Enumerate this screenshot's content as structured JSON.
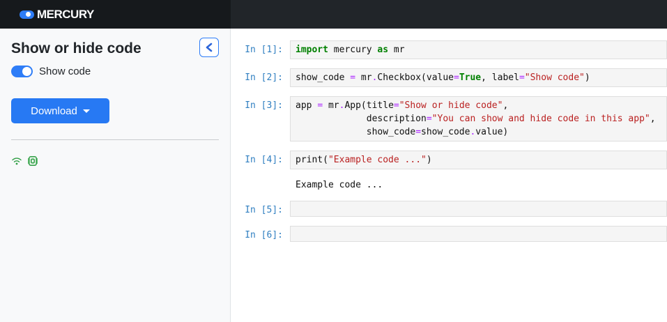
{
  "header": {
    "brand": "MERCURY"
  },
  "sidebar": {
    "title": "Show or hide code",
    "show_code_label": "Show code",
    "show_code_value": true,
    "download_label": "Download"
  },
  "colors": {
    "accent_blue": "#2779f3",
    "toggle_blue": "#2e7df7",
    "status_green": "#2f9e44",
    "prompt_blue": "#307fc1",
    "keyword_green": "#008000",
    "operator_violet": "#AA22FF",
    "string_red": "#BA2121",
    "navbar_dark": "#212529",
    "sidebar_bg": "#f8f9fa",
    "cell_bg": "#f5f5f5"
  },
  "notebook": {
    "cells": [
      {
        "prompt": "In [1]:",
        "lines": [
          [
            [
              "k",
              "import"
            ],
            [
              "t",
              " mercury "
            ],
            [
              "k",
              "as"
            ],
            [
              "t",
              " mr"
            ]
          ]
        ]
      },
      {
        "prompt": "In [2]:",
        "lines": [
          [
            [
              "t",
              "show_code "
            ],
            [
              "o",
              "="
            ],
            [
              "t",
              " mr"
            ],
            [
              "o",
              "."
            ],
            [
              "t",
              "Checkbox(value"
            ],
            [
              "o",
              "="
            ],
            [
              "k",
              "True"
            ],
            [
              "t",
              ", label"
            ],
            [
              "o",
              "="
            ],
            [
              "s",
              "\"Show code\""
            ],
            [
              "t",
              ")"
            ]
          ]
        ]
      },
      {
        "prompt": "In [3]:",
        "lines": [
          [
            [
              "t",
              "app "
            ],
            [
              "o",
              "="
            ],
            [
              "t",
              " mr"
            ],
            [
              "o",
              "."
            ],
            [
              "t",
              "App(title"
            ],
            [
              "o",
              "="
            ],
            [
              "s",
              "\"Show or hide code\""
            ],
            [
              "t",
              ","
            ]
          ],
          [
            [
              "t",
              "             description"
            ],
            [
              "o",
              "="
            ],
            [
              "s",
              "\"You can show and hide code in this app\""
            ],
            [
              "t",
              ","
            ]
          ],
          [
            [
              "t",
              "             show_code"
            ],
            [
              "o",
              "="
            ],
            [
              "t",
              "show_code"
            ],
            [
              "o",
              "."
            ],
            [
              "t",
              "value)"
            ]
          ]
        ]
      },
      {
        "prompt": "In [4]:",
        "lines": [
          [
            [
              "t",
              "print("
            ],
            [
              "s",
              "\"Example code ...\""
            ],
            [
              "t",
              ")"
            ]
          ]
        ],
        "output": "Example code ..."
      },
      {
        "prompt": "In [5]:",
        "lines": []
      },
      {
        "prompt": "In [6]:",
        "lines": []
      }
    ]
  }
}
